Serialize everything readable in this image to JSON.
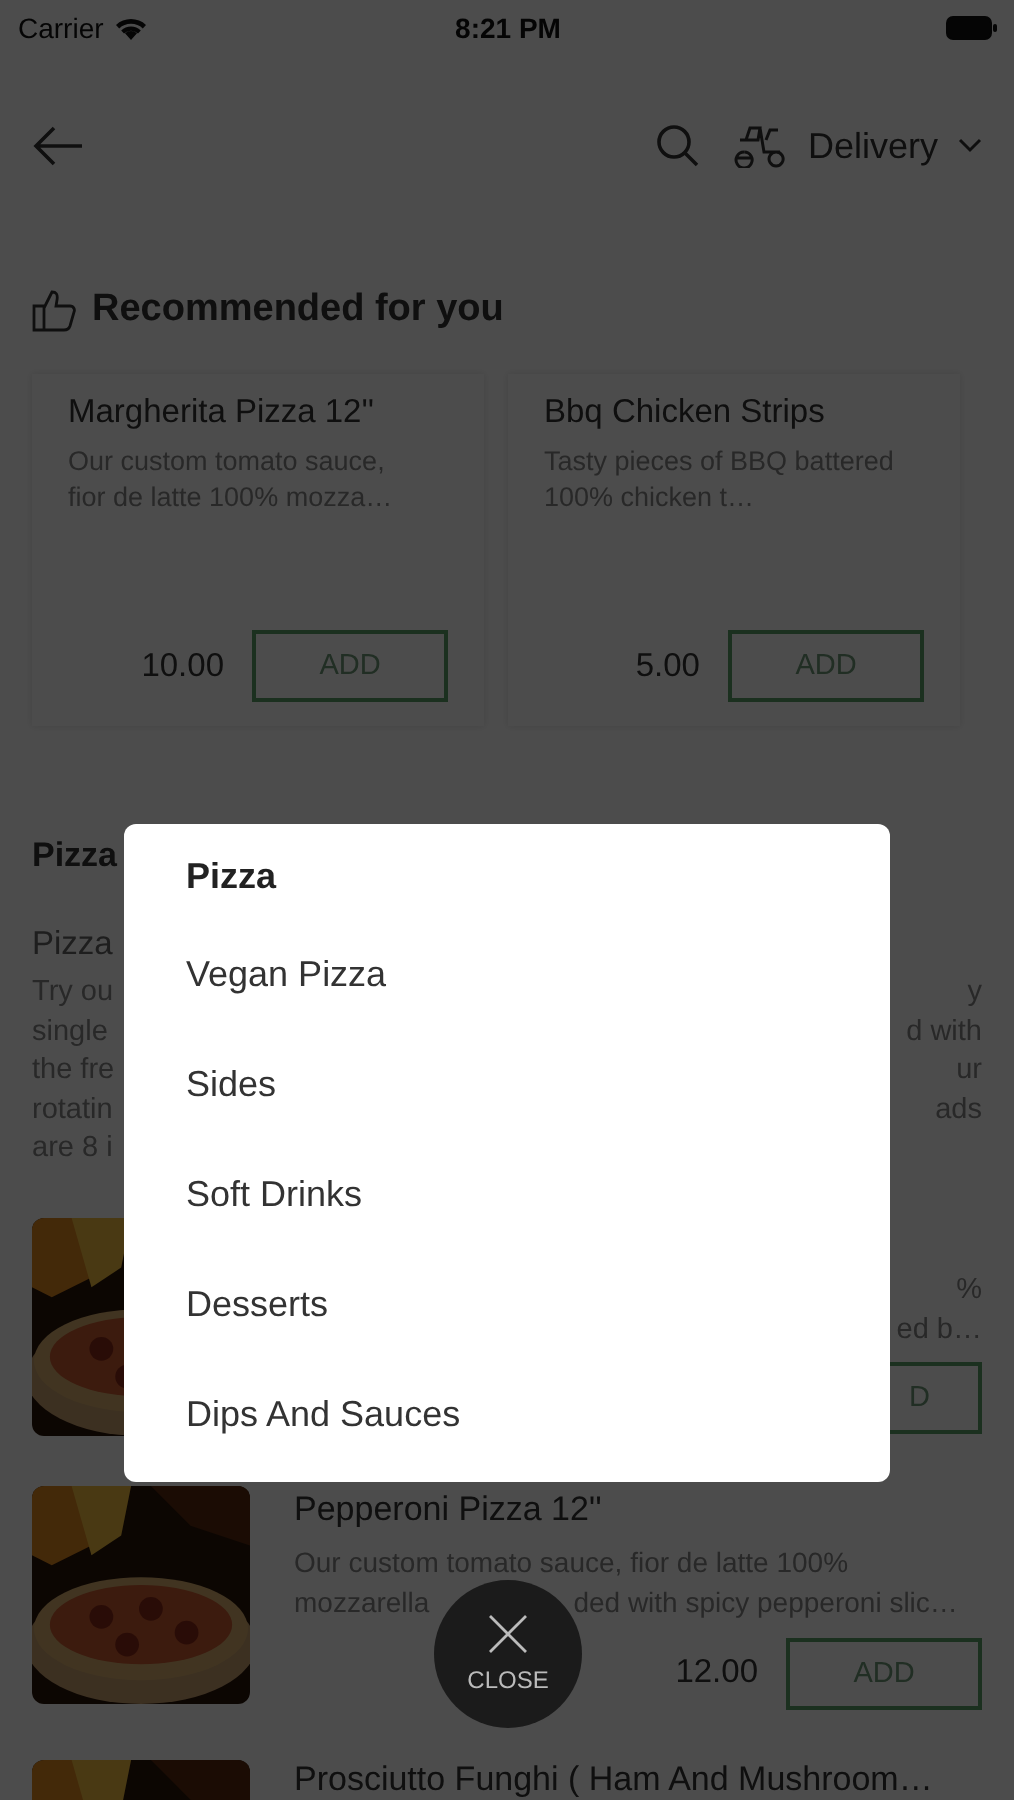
{
  "status_bar": {
    "carrier": "Carrier",
    "time": "8:21 PM"
  },
  "header": {
    "delivery_label": "Delivery"
  },
  "recommended": {
    "title": "Recommended for you",
    "items": [
      {
        "name": "Margherita Pizza 12''",
        "description": "Our custom tomato sauce, fior de latte 100% mozza…",
        "price": "10.00",
        "button": "ADD"
      },
      {
        "name": "Bbq Chicken Strips",
        "description": "Tasty pieces of BBQ battered 100% chicken t…",
        "price": "5.00",
        "button": "ADD"
      }
    ]
  },
  "section": {
    "title": "Pizza",
    "subtitle": "Pizza",
    "lines": [
      {
        "left": "Try ou",
        "right": "y"
      },
      {
        "left": "single",
        "right": "d with"
      },
      {
        "left": "the fre",
        "right": "ur"
      },
      {
        "left": "rotatin",
        "right": "ads"
      },
      {
        "left": "are 8 i"
      }
    ]
  },
  "items": [
    {
      "kind": "partial",
      "description_right": [
        "%",
        "ed b…"
      ],
      "button": "D"
    },
    {
      "kind": "full",
      "name": "Pepperoni Pizza 12''",
      "description_lines": [
        [
          "Our custom tomato sauce, fior de latte 100%"
        ],
        [
          "mozzarella",
          "ded with spicy pepperoni slic…"
        ]
      ],
      "price": "12.00",
      "button": "ADD"
    },
    {
      "kind": "cut",
      "name": "Prosciutto Funghi ( Ham And Mushroom…"
    }
  ],
  "category_menu": {
    "items": [
      {
        "label": "Pizza",
        "selected": true
      },
      {
        "label": "Vegan Pizza",
        "selected": false
      },
      {
        "label": "Sides",
        "selected": false
      },
      {
        "label": "Soft Drinks",
        "selected": false
      },
      {
        "label": "Desserts",
        "selected": false
      },
      {
        "label": "Dips And Sauces",
        "selected": false
      }
    ],
    "close_label": "CLOSE"
  }
}
